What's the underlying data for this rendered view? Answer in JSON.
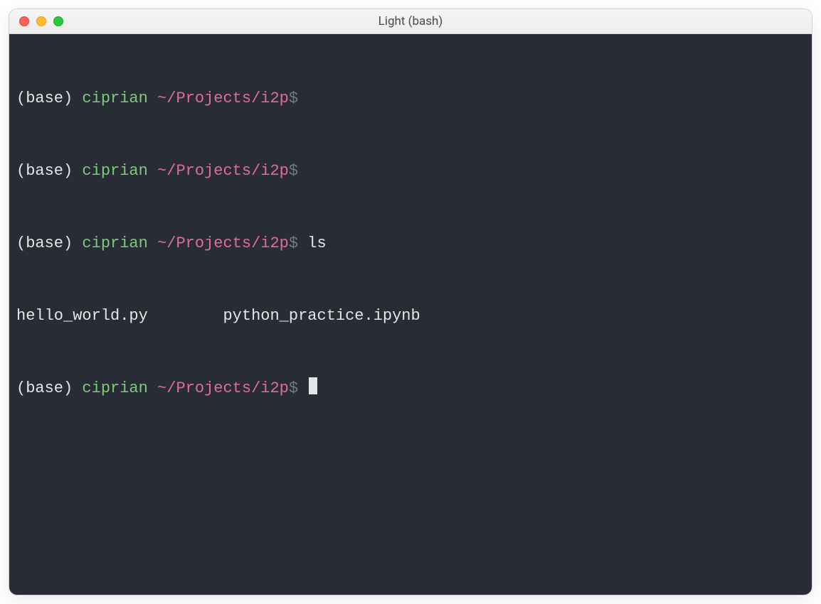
{
  "window": {
    "title": "Light (bash)"
  },
  "prompt": {
    "env": "(base)",
    "user": "ciprian",
    "path": "~/Projects/i2p",
    "symbol": "$"
  },
  "lines": [
    {
      "type": "prompt",
      "command": ""
    },
    {
      "type": "prompt",
      "command": ""
    },
    {
      "type": "prompt",
      "command": "ls"
    },
    {
      "type": "prompt_cursor",
      "command": ""
    }
  ],
  "ls_output": {
    "file1": "hello_world.py",
    "spacer": "        ",
    "file2": "python_practice.ipynb"
  }
}
